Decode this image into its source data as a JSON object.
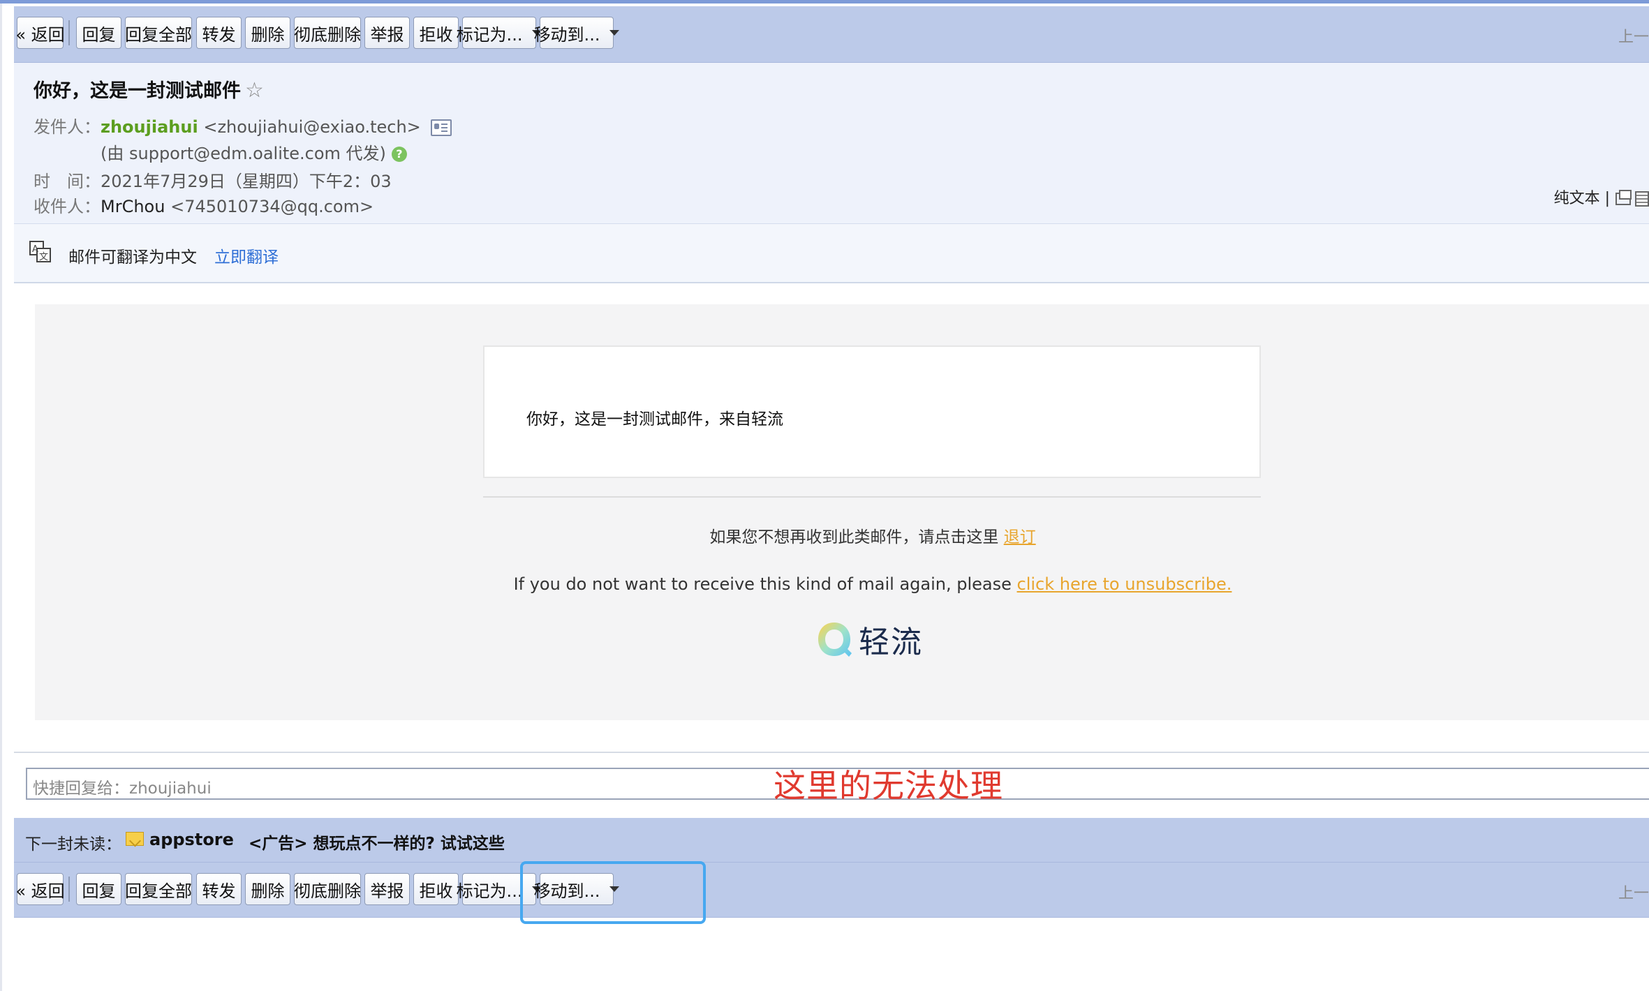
{
  "toolbar": {
    "back": "« 返回",
    "reply": "回复",
    "reply_all": "回复全部",
    "forward": "转发",
    "delete": "删除",
    "delete_forever": "彻底删除",
    "report": "举报",
    "reject": "拒收",
    "mark_as": "标记为...",
    "move_to": "移动到...",
    "prev": "上一"
  },
  "email": {
    "subject": "你好，这是一封测试邮件",
    "sender_label": "发件人：",
    "sender_name": "zhoujiahui",
    "sender_email": "<zhoujiahui@exiao.tech>",
    "via": "(由 support@edm.oalite.com 代发)",
    "time_label": "时　间：",
    "time": "2021年7月29日（星期四）下午2：03",
    "to_label": "收件人：",
    "to_name": "MrChou",
    "to_email": "<745010734@qq.com>",
    "view_plain": "纯文本 |"
  },
  "translate": {
    "text": "邮件可翻译为中文",
    "link": "立即翻译"
  },
  "body": {
    "content": "你好，这是一封测试邮件，来自轻流",
    "unsub_cn_prefix": "如果您不想再收到此类邮件，请点击这里",
    "unsub_cn_link": "退订",
    "unsub_en_prefix": "If you do not want to receive this kind of mail again, please",
    "unsub_en_link": "click here to unsubscribe.",
    "brand": "轻流"
  },
  "quick_reply": {
    "placeholder": "快捷回复给：zhoujiahui"
  },
  "annotation": "这里的无法处理",
  "next_unread": {
    "label": "下一封未读：",
    "sender": "appstore",
    "subject": "<广告> 想玩点不一样的? 试试这些"
  },
  "colors": {
    "toolbar_bg": "#bccae9",
    "header_bg": "#eef2fb",
    "sender_green": "#5c9e1f",
    "link_blue": "#2f6fd6",
    "unsub_orange": "#e8a52d",
    "annotation_red": "#e03a2f",
    "highlight_blue": "#47a8f0"
  }
}
